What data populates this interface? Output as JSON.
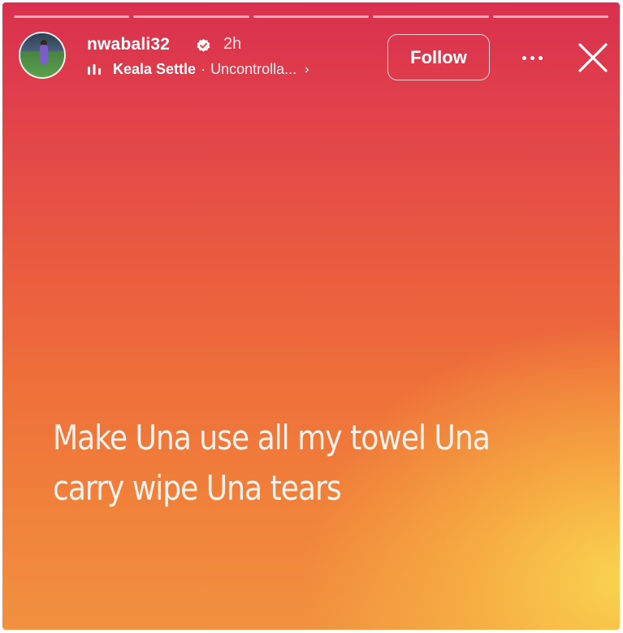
{
  "story": {
    "progress_segments": 5,
    "progress_completed": 0,
    "user": {
      "username": "nwabali32",
      "verified": true,
      "posted_ago": "2h"
    },
    "music": {
      "icon": "audio-bars-icon",
      "artist": "Keala Settle",
      "separator": "·",
      "song": "Uncontrolla...",
      "chevron": "›"
    },
    "follow_label": "Follow",
    "more_icon": "more-horizontal-icon",
    "close_icon": "close-icon",
    "caption_lines": [
      "Make Una use all my towel Una",
      "carry wipe Una tears"
    ],
    "background_colors": {
      "top": "#d9304f",
      "middle": "#ee6f3a",
      "bottom": "#f29140",
      "glow": "#fad650"
    }
  }
}
